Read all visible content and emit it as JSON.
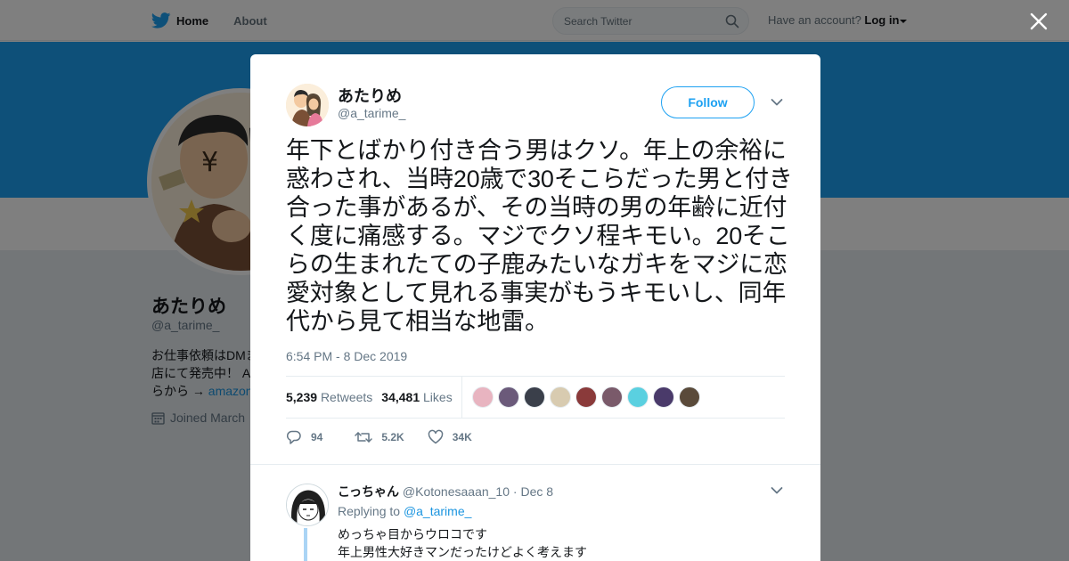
{
  "nav": {
    "home_label": "Home",
    "about_label": "About",
    "search_placeholder": "Search Twitter",
    "have_account": "Have an account?",
    "login_label": "Log in"
  },
  "profile": {
    "name": "あたりめ",
    "handle": "@a_tarime_",
    "bio_line1": "お仕事依頼はDMま",
    "bio_line2": "店にて発売中！ A",
    "bio_line3": "らから → ",
    "bio_link": "amazon",
    "joined": "Joined March"
  },
  "tweet": {
    "name": "あたりめ",
    "handle": "@a_tarime_",
    "follow_label": "Follow",
    "text": "年下とばかり付き合う男はクソ。年上の余裕に惑わされ、当時20歳で30そこらだった男と付き合った事があるが、その当時の男の年齢に近付く度に痛感する。マジでクソ程キモい。20そこらの生まれたての子鹿みたいなガキをマジに恋愛対象として見れる事実がもうキモいし、同年代から見て相当な地雷。",
    "time": "6:54 PM - 8 Dec 2019",
    "retweets_count": "5,239",
    "retweets_label": "Retweets",
    "likes_count": "34,481",
    "likes_label": "Likes",
    "liker_colors": [
      "#e8b4c0",
      "#6b5a7a",
      "#3a3f4a",
      "#d8cbb0",
      "#8a3a3a",
      "#7a5a6a",
      "#5ad0e0",
      "#4a3a6a",
      "#5a4a3a"
    ],
    "reply_count": "94",
    "retweet_short": "5.2K",
    "like_short": "34K"
  },
  "reply": {
    "name": "こっちゃん",
    "handle": "@Kotonesaaan_10",
    "date": "· Dec 8",
    "replying_to": "Replying to ",
    "mention": "@a_tarime_",
    "line1": "めっちゃ目からウロコです",
    "line2": "年上男性大好きマンだったけどよく考えます"
  },
  "colors": {
    "accent": "#1da1f2",
    "banner": "#1da1f2",
    "muted": "#657786"
  },
  "icons": [
    "twitter-bird-icon",
    "search-icon",
    "close-icon",
    "chevron-down-icon",
    "calendar-icon",
    "reply-icon",
    "retweet-icon",
    "heart-icon"
  ]
}
